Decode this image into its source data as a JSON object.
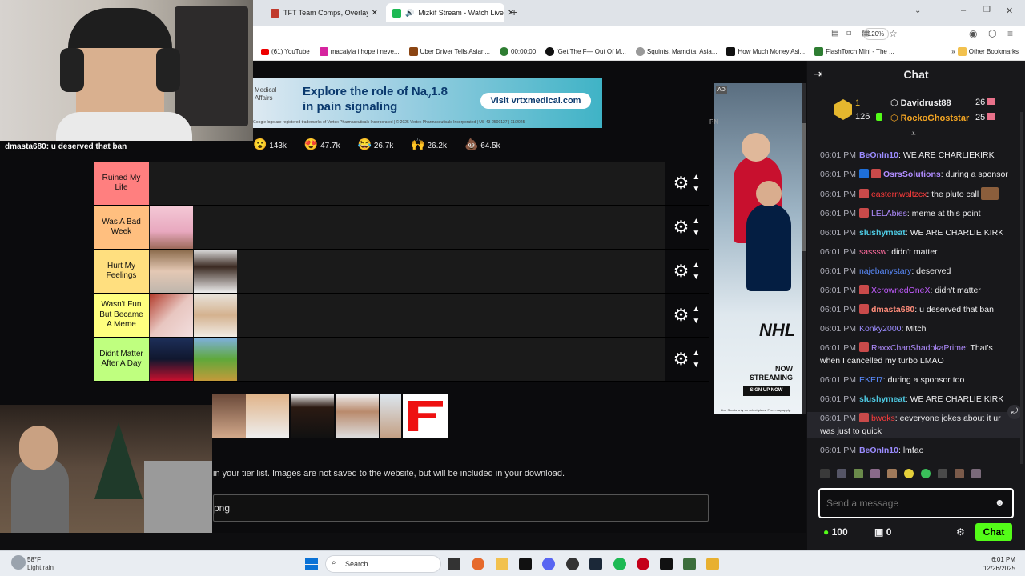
{
  "browser": {
    "tabs": [
      {
        "label": "TFT Team Comps, Overlay, and I",
        "active": false
      },
      {
        "label": "Mizkif Stream - Watch Live",
        "active": true
      }
    ],
    "zoom": "120%",
    "bookmarks": [
      "(61) YouTube",
      "macaiyla i hope i neve...",
      "Uber Driver Tells Asian...",
      "00:00:00",
      "'Get The F— Out Of M...",
      "Squints, Mamcita, Asia...",
      "How Much Money Asi...",
      "FlashTorch Mini - The ..."
    ],
    "other_bookmarks": "Other Bookmarks"
  },
  "webcam_overlay": {
    "caption": "dmasta680: u deserved that ban"
  },
  "ad_banner": {
    "brand": "Medical Affairs",
    "headline": "Explore the role of Na",
    "headline_sub": "v",
    "headline_num": "1.8",
    "headline_line2": "in pain signaling",
    "cta": "Visit vrtxmedical.com",
    "fine_print": "Google logo are registered trademarks of Vertex Pharmaceuticals Incorporated | © 2025 Vertex Pharmaceuticals Incorporated | US-43-2500127 | 11/2025"
  },
  "reactions": [
    {
      "emoji": "😮",
      "count": "143k"
    },
    {
      "emoji": "😍",
      "count": "47.7k"
    },
    {
      "emoji": "😂",
      "count": "26.7k"
    },
    {
      "emoji": "🙌",
      "count": "26.2k"
    },
    {
      "emoji": "💩",
      "count": "64.5k"
    }
  ],
  "tiers": [
    {
      "label": "Ruined My Life",
      "color": "#ff7f7f"
    },
    {
      "label": "Was A Bad Week",
      "color": "#ffbf7f"
    },
    {
      "label": "Hurt My Feelings",
      "color": "#ffdf7f"
    },
    {
      "label": "Wasn't Fun But Became A Meme",
      "color": "#ffff7f"
    },
    {
      "label": "Didnt Matter After A Day",
      "color": "#bfff7f"
    }
  ],
  "tierlist": {
    "info_text": "in your tier list. Images are not saved to the website, but will be included in your download.",
    "filename_value": "png"
  },
  "side_ad": {
    "league": "NHL",
    "now_streaming": "NOW STREAMING",
    "signup": "SIGN UP NOW",
    "ad_label": "AD",
    "corner_label": "PN",
    "fine": "Live Sports only on select plans. Fees may apply."
  },
  "chat": {
    "title": "Chat",
    "leaderboard": [
      {
        "rank": "1",
        "name": "Davidrust88",
        "score": "26"
      },
      {
        "rank": "126",
        "name": "RockoGhoststar",
        "score": "25"
      }
    ],
    "messages": [
      {
        "time": "06:01 PM",
        "user": "BeOnIn10",
        "color": "#9b8cff",
        "text": "WE ARE CHARLIEKIRK"
      },
      {
        "time": "06:01 PM",
        "user": "OsrsSolutions",
        "color": "#b08cff",
        "text": "during a sponsor"
      },
      {
        "time": "06:01 PM",
        "user": "easternwaltzcx",
        "color": "#ff3b3b",
        "text": "the pluto call"
      },
      {
        "time": "06:01 PM",
        "user": "LELAbies",
        "color": "#b08cff",
        "text": "meme at this point"
      },
      {
        "time": "06:01 PM",
        "user": "slushymeat",
        "color": "#4ecbe4",
        "text": "WE ARE CHARLIE KIRK"
      },
      {
        "time": "06:01 PM",
        "user": "sasssw",
        "color": "#ff6b9d",
        "text": "didn't matter"
      },
      {
        "time": "06:01 PM",
        "user": "najebanystary",
        "color": "#5a8cff",
        "text": "deserved"
      },
      {
        "time": "06:01 PM",
        "user": "XcrownedOneX",
        "color": "#c25cff",
        "text": "didn't matter"
      },
      {
        "time": "06:01 PM",
        "user": "dmasta680",
        "color": "#ff8c7a",
        "text": "u deserved that ban"
      },
      {
        "time": "06:01 PM",
        "user": "Konky2000",
        "color": "#9b8cff",
        "text": "Mitch"
      },
      {
        "time": "06:01 PM",
        "user": "RaxxChanShadokaPrime",
        "color": "#b08cff",
        "text": "That's when I cancelled my turbo LMAO"
      },
      {
        "time": "06:01 PM",
        "user": "EKEI7",
        "color": "#5a8cff",
        "text": "during a sponsor too"
      },
      {
        "time": "06:01 PM",
        "user": "slushymeat",
        "color": "#4ecbe4",
        "text": "WE ARE CHARLIE KIRK"
      },
      {
        "time": "06:01 PM",
        "user": "bwoks",
        "color": "#ff3b3b",
        "text": "eeveryone jokes about it ur was just to quick"
      },
      {
        "time": "06:01 PM",
        "user": "BeOnIn10",
        "color": "#9b8cff",
        "text": "lmfao"
      }
    ],
    "input_placeholder": "Send a message",
    "points": "100",
    "gift_count": "0",
    "chat_button": "Chat"
  },
  "taskbar": {
    "weather_temp": "58°F",
    "weather_desc": "Light rain",
    "search": "Search",
    "time": "6:01 PM",
    "date": "12/26/2025"
  }
}
